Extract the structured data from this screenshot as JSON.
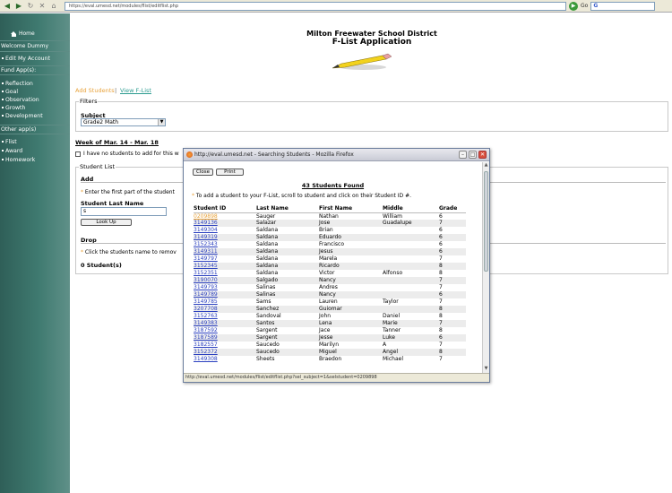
{
  "browser": {
    "url": "https://eval.umesd.net/modules/flist/editflist.php",
    "go_label": "Go",
    "google_label": "G"
  },
  "sidebar": {
    "home_label": "Home",
    "welcome": "Welcome Dummy",
    "edit_account": "Edit My Account",
    "fund_apps_header": "Fund App(s):",
    "fund_apps": [
      "Reflection",
      "Goal",
      "Observation",
      "Growth",
      "Development"
    ],
    "other_apps_header": "Other app(s)",
    "other_apps": [
      "Flist",
      "Award",
      "Homework"
    ]
  },
  "header": {
    "district": "Milton Freewater School District",
    "app_title": "F-List Application"
  },
  "nav": {
    "add_students": "Add Students",
    "separator": "|",
    "view_flist": "View F-List"
  },
  "filters": {
    "legend": "Filters",
    "subject_label": "Subject",
    "subject_value": "Grade2 Math"
  },
  "week": {
    "label": "Week of Mar. 14 - Mar. 18",
    "no_students_text": "I have no students to add for this w"
  },
  "student_list": {
    "legend": "Student List",
    "add_header": "Add",
    "enter_text": "Enter the first part of the student",
    "last_name_label": "Student Last Name",
    "last_name_value": "s",
    "lookup_button": "Look Up",
    "drop_header": "Drop",
    "click_text": "Click the students name to remov",
    "count": "0 Student(s)"
  },
  "popup": {
    "title": "http://eval.umesd.net - Searching Students - Mozilla Firefox",
    "close_button": "Close",
    "print_button": "Print",
    "found_text": "43 Students Found",
    "instructions": "To add a student to your F-List, scroll to student and click on their Student ID #.",
    "columns": [
      "Student ID",
      "Last Name",
      "First Name",
      "Middle",
      "Grade"
    ],
    "status_url": "http://eval.umesd.net/modules/flist/editflist.php?sel_subject=1&selstudent=0209898",
    "rows": [
      [
        "0209898",
        "Sauger",
        "Nathan",
        "William",
        "6"
      ],
      [
        "3149136",
        "Salazar",
        "Jose",
        "Guadalupe",
        "7"
      ],
      [
        "3149304",
        "Saldana",
        "Brian",
        "",
        "6"
      ],
      [
        "3149319",
        "Saldana",
        "Eduardo",
        "",
        "6"
      ],
      [
        "3152343",
        "Saldana",
        "Francisco",
        "",
        "6"
      ],
      [
        "3149311",
        "Saldana",
        "Jesus",
        "",
        "6"
      ],
      [
        "3149797",
        "Saldana",
        "Marela",
        "",
        "7"
      ],
      [
        "3152345",
        "Saldana",
        "Ricardo",
        "",
        "8"
      ],
      [
        "3152351",
        "Saldana",
        "Victor",
        "Alfonso",
        "8"
      ],
      [
        "3190070",
        "Salgado",
        "Nancy",
        "",
        "7"
      ],
      [
        "3149793",
        "Salinas",
        "Andres",
        "",
        "7"
      ],
      [
        "3149789",
        "Salinas",
        "Nancy",
        "",
        "6"
      ],
      [
        "3149785",
        "Sams",
        "Lauren",
        "Taylor",
        "7"
      ],
      [
        "3207708",
        "Sanchez",
        "Guiomar",
        "",
        "8"
      ],
      [
        "3152763",
        "Sandoval",
        "John",
        "Daniel",
        "8"
      ],
      [
        "3149383",
        "Santos",
        "Lena",
        "Marie",
        "7"
      ],
      [
        "3187592",
        "Sargent",
        "Jace",
        "Tanner",
        "8"
      ],
      [
        "3187589",
        "Sargent",
        "Jesse",
        "Luke",
        "6"
      ],
      [
        "3182557",
        "Saucedo",
        "Marilyn",
        "A",
        "7"
      ],
      [
        "3152372",
        "Saucedo",
        "Miguel",
        "Angel",
        "8"
      ],
      [
        "3149308",
        "Sheets",
        "Braedon",
        "Michael",
        "7"
      ]
    ]
  }
}
